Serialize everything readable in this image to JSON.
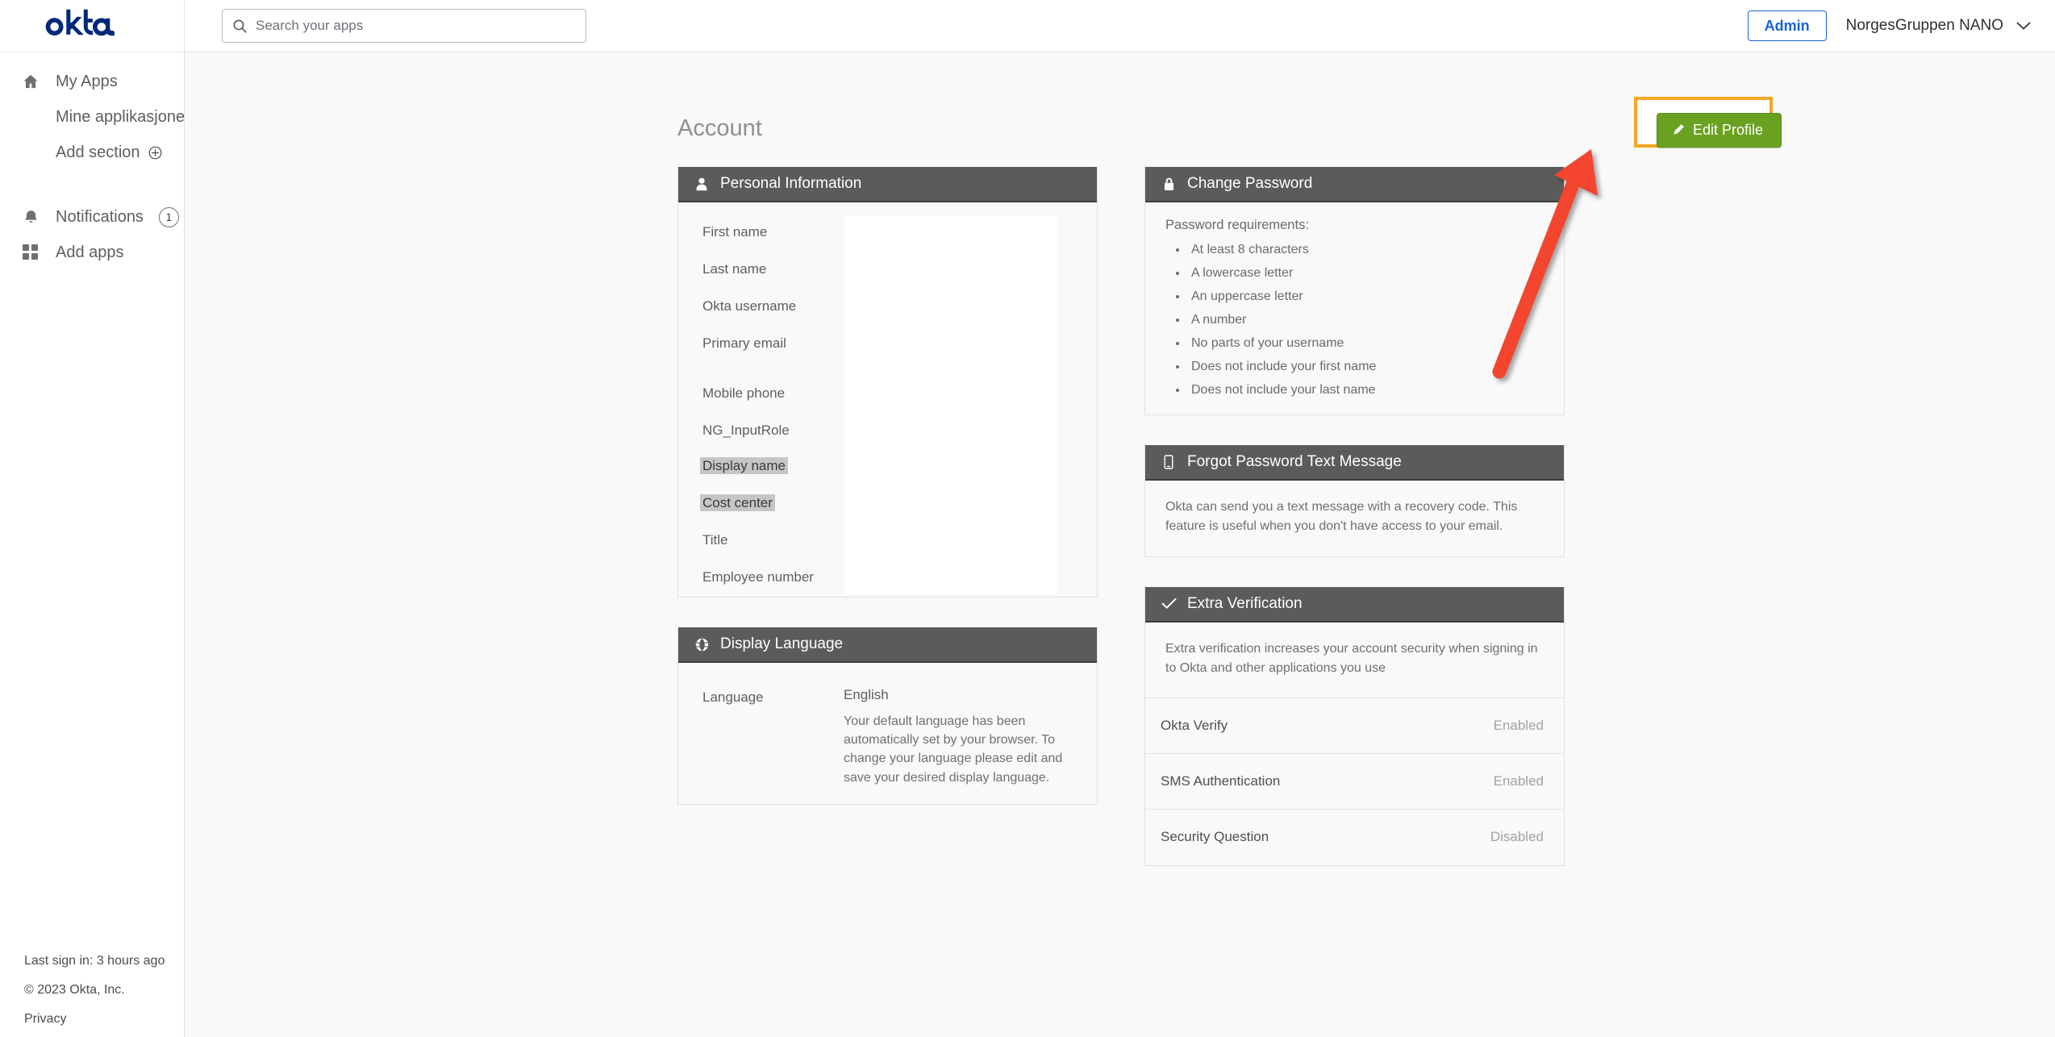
{
  "brand": {
    "logo_text": "okta",
    "logo_color": "#00297a"
  },
  "sidebar": {
    "items": [
      {
        "label": "My Apps",
        "icon": "home-icon"
      },
      {
        "label": "Mine applikasjoner",
        "icon": null
      },
      {
        "label": "Add section",
        "icon": null,
        "suffix_icon": "plus-circle-icon"
      },
      {
        "label": "Notifications",
        "icon": "bell-icon",
        "badge": "1"
      },
      {
        "label": "Add apps",
        "icon": "grid-icon"
      }
    ],
    "footer": {
      "last_sign_in": "Last sign in: 3 hours ago",
      "copyright": "© 2023 Okta, Inc.",
      "privacy": "Privacy"
    }
  },
  "topbar": {
    "search_placeholder": "Search your apps",
    "search_value": "",
    "admin_label": "Admin",
    "user_name": "NorgesGruppen NANO",
    "admin_color": "#1662dd"
  },
  "page": {
    "title": "Account"
  },
  "edit_profile": {
    "label": "Edit Profile",
    "color": "#6aa121"
  },
  "annotation": {
    "highlight_color": "#f5a623",
    "arrow_color": "#f4442e"
  },
  "personal_information": {
    "title": "Personal Information",
    "icon": "person-icon",
    "fields": [
      {
        "label": "First name",
        "value": "",
        "highlighted": false
      },
      {
        "label": "Last name",
        "value": "",
        "highlighted": false
      },
      {
        "label": "Okta username",
        "value": "",
        "highlighted": false
      },
      {
        "label": "Primary email",
        "value": "",
        "highlighted": false
      },
      {
        "label": "Mobile phone",
        "value": "",
        "highlighted": false
      },
      {
        "label": "NG_InputRole",
        "value": "",
        "highlighted": false
      },
      {
        "label": "Display name",
        "value": "",
        "highlighted": true
      },
      {
        "label": "Cost center",
        "value": "",
        "highlighted": true
      },
      {
        "label": "Title",
        "value": "",
        "highlighted": false
      },
      {
        "label": "Employee number",
        "value": "",
        "highlighted": false
      }
    ]
  },
  "display_language": {
    "title": "Display Language",
    "icon": "globe-icon",
    "label": "Language",
    "value": "English",
    "note": "Your default language has been automatically set by your browser. To change your language please edit and save your desired display language."
  },
  "change_password": {
    "title": "Change Password",
    "icon": "lock-icon",
    "requirements_title": "Password requirements:",
    "requirements": [
      "At least 8 characters",
      "A lowercase letter",
      "An uppercase letter",
      "A number",
      "No parts of your username",
      "Does not include your first name",
      "Does not include your last name"
    ]
  },
  "forgot_password": {
    "title": "Forgot Password Text Message",
    "icon": "phone-icon",
    "description": "Okta can send you a text message with a recovery code. This feature is useful when you don't have access to your email."
  },
  "extra_verification": {
    "title": "Extra Verification",
    "icon": "check-icon",
    "description": "Extra verification increases your account security when signing in to Okta and other applications you use",
    "factors": [
      {
        "name": "Okta Verify",
        "status": "Enabled"
      },
      {
        "name": "SMS Authentication",
        "status": "Enabled"
      },
      {
        "name": "Security Question",
        "status": "Disabled"
      }
    ]
  }
}
